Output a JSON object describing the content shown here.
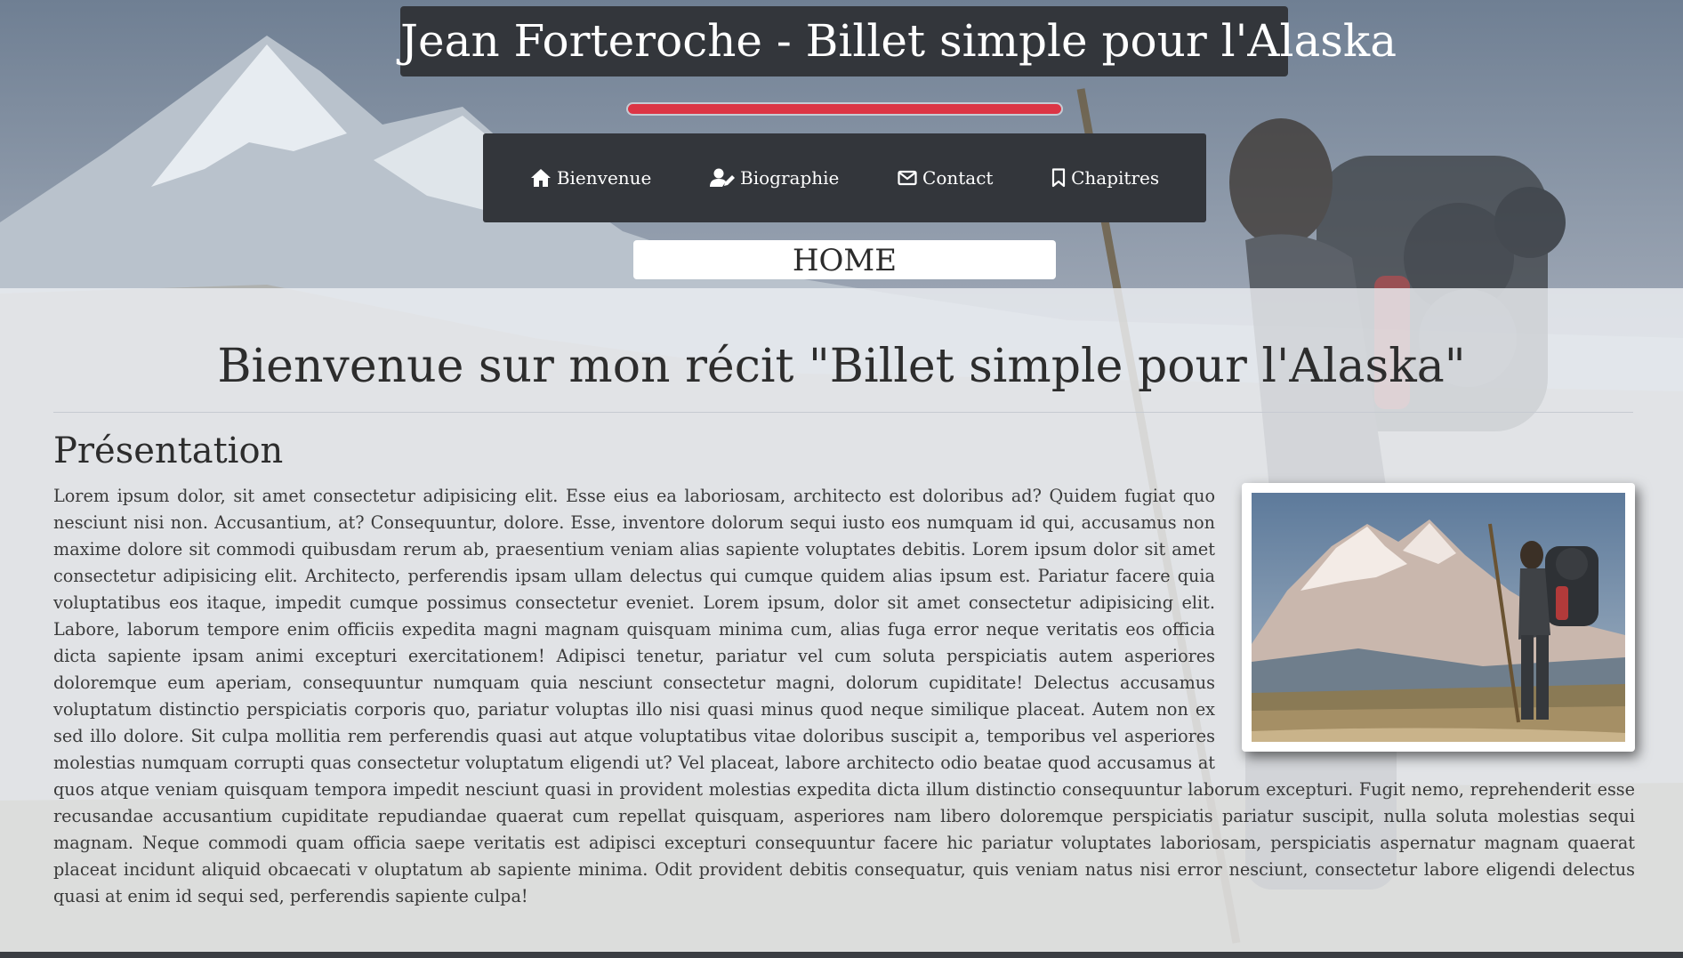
{
  "header": {
    "site_title": "Jean Forteroche - Billet simple pour l'Alaska",
    "accent_color": "#dc3545"
  },
  "nav": {
    "items": [
      {
        "label": "Bienvenue",
        "icon": "home-icon"
      },
      {
        "label": "Biographie",
        "icon": "user-edit-icon"
      },
      {
        "label": "Contact",
        "icon": "envelope-icon"
      },
      {
        "label": "Chapitres",
        "icon": "bookmark-icon"
      }
    ]
  },
  "page_label": "HOME",
  "main": {
    "heading": "Bienvenue sur mon récit \"Billet simple pour l'Alaska\"",
    "section_title": "Présentation",
    "body": "Lorem ipsum dolor, sit amet consectetur adipisicing elit. Esse eius ea laboriosam, architecto est doloribus ad? Quidem fugiat quo nesciunt nisi non. Accusantium, at? Consequuntur, dolore. Esse, inventore dolorum sequi iusto eos numquam id qui, accusamus non maxime dolore sit commodi quibusdam rerum ab, praesentium veniam alias sapiente voluptates debitis. Lorem ipsum dolor sit amet consectetur adipisicing elit. Architecto, perferendis ipsam ullam delectus qui cumque quidem alias ipsum est. Pariatur facere quia voluptatibus eos itaque, impedit cumque possimus consectetur eveniet. Lorem ipsum, dolor sit amet consectetur adipisicing elit. Labore, laborum tempore enim officiis expedita magni magnam quisquam minima cum, alias fuga error neque veritatis eos officia dicta sapiente ipsam animi excepturi exercitationem! Adipisci tenetur, pariatur vel cum soluta perspiciatis autem asperiores doloremque eum aperiam, consequuntur numquam quia nesciunt consectetur magni, dolorum cupiditate! Delectus accusamus voluptatum distinctio perspiciatis corporis quo, pariatur voluptas illo nisi quasi minus quod neque similique placeat. Autem non ex sed illo dolore. Sit culpa mollitia rem perferendis quasi aut atque voluptatibus vitae doloribus suscipit a, temporibus vel asperiores molestias numquam corrupti quas consectetur voluptatum eligendi ut? Vel placeat, labore architecto odio beatae quod accusamus at quos atque veniam quisquam tempora impedit nesciunt quasi in provident molestias expedita dicta illum distinctio consequuntur laborum excepturi. Fugit nemo, reprehenderit esse recusandae accusantium cupiditate repudiandae quaerat cum repellat quisquam, asperiores nam libero doloremque perspiciatis pariatur suscipit, nulla soluta molestias sequi magnam. Neque commodi quam officia saepe veritatis est adipisci excepturi consequuntur facere hic pariatur voluptates laboriosam, perspiciatis aspernatur magnam quaerat placeat incidunt aliquid obcaecati v oluptatum ab sapiente minima. Odit provident debitis consequatur, quis veniam natus nisi error nesciunt, consectetur labore eligendi delectus quasi at enim id sequi sed, perferendis sapiente culpa!"
  }
}
